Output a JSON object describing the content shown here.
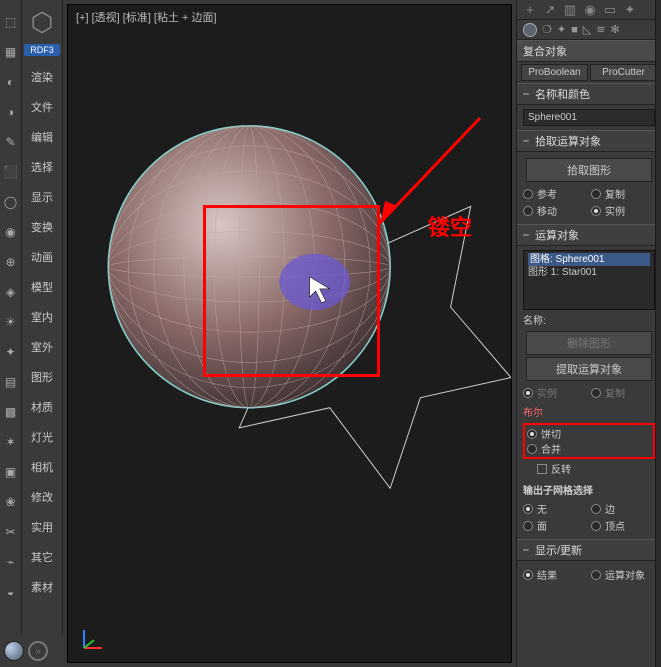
{
  "viewport": {
    "label": "[+] [透视] [标准] [粘土 + 边面]",
    "annotation": "镂空"
  },
  "sidebar": {
    "tag": "RDF3",
    "items": [
      "渲染",
      "文件",
      "编辑",
      "选择",
      "显示",
      "变换",
      "动画",
      "模型",
      "室内",
      "室外",
      "图形",
      "材质",
      "灯光",
      "相机",
      "修改",
      "实用",
      "其它",
      "素材"
    ]
  },
  "right": {
    "category": "复合对象",
    "typeButtons": [
      "ProBoolean",
      "ProCutter"
    ],
    "rollouts": {
      "nameColor": {
        "title": "名称和颜色",
        "value": "Sphere001"
      },
      "pickOperand": {
        "title": "拾取运算对象",
        "button": "拾取图形",
        "opts": {
          "a": "参考",
          "b": "复制",
          "c": "移动",
          "d": "实例"
        },
        "selected": "d"
      },
      "operands": {
        "title": "运算对象",
        "items": [
          "图格: Sphere001",
          "图形 1: Star001"
        ],
        "selectedIndex": 0,
        "nameLabel": "名称:",
        "btn1": "删除图形",
        "btn2": "提取运算对象",
        "extOpts": {
          "a": "实例",
          "b": "复制"
        },
        "extSelected": "a",
        "boolLabel": "布尔",
        "boolOpts": {
          "a": "饼切",
          "b": "合并",
          "c": "反转"
        },
        "boolSelected": "a",
        "outputTitle": "输出子网格选择",
        "outOpts": {
          "a": "无",
          "b": "边",
          "c": "面",
          "d": "顶点"
        },
        "outSelected": "a"
      },
      "display": {
        "title": "显示/更新",
        "opts": {
          "a": "结果",
          "b": "运算对象"
        },
        "selected": "a"
      }
    }
  }
}
